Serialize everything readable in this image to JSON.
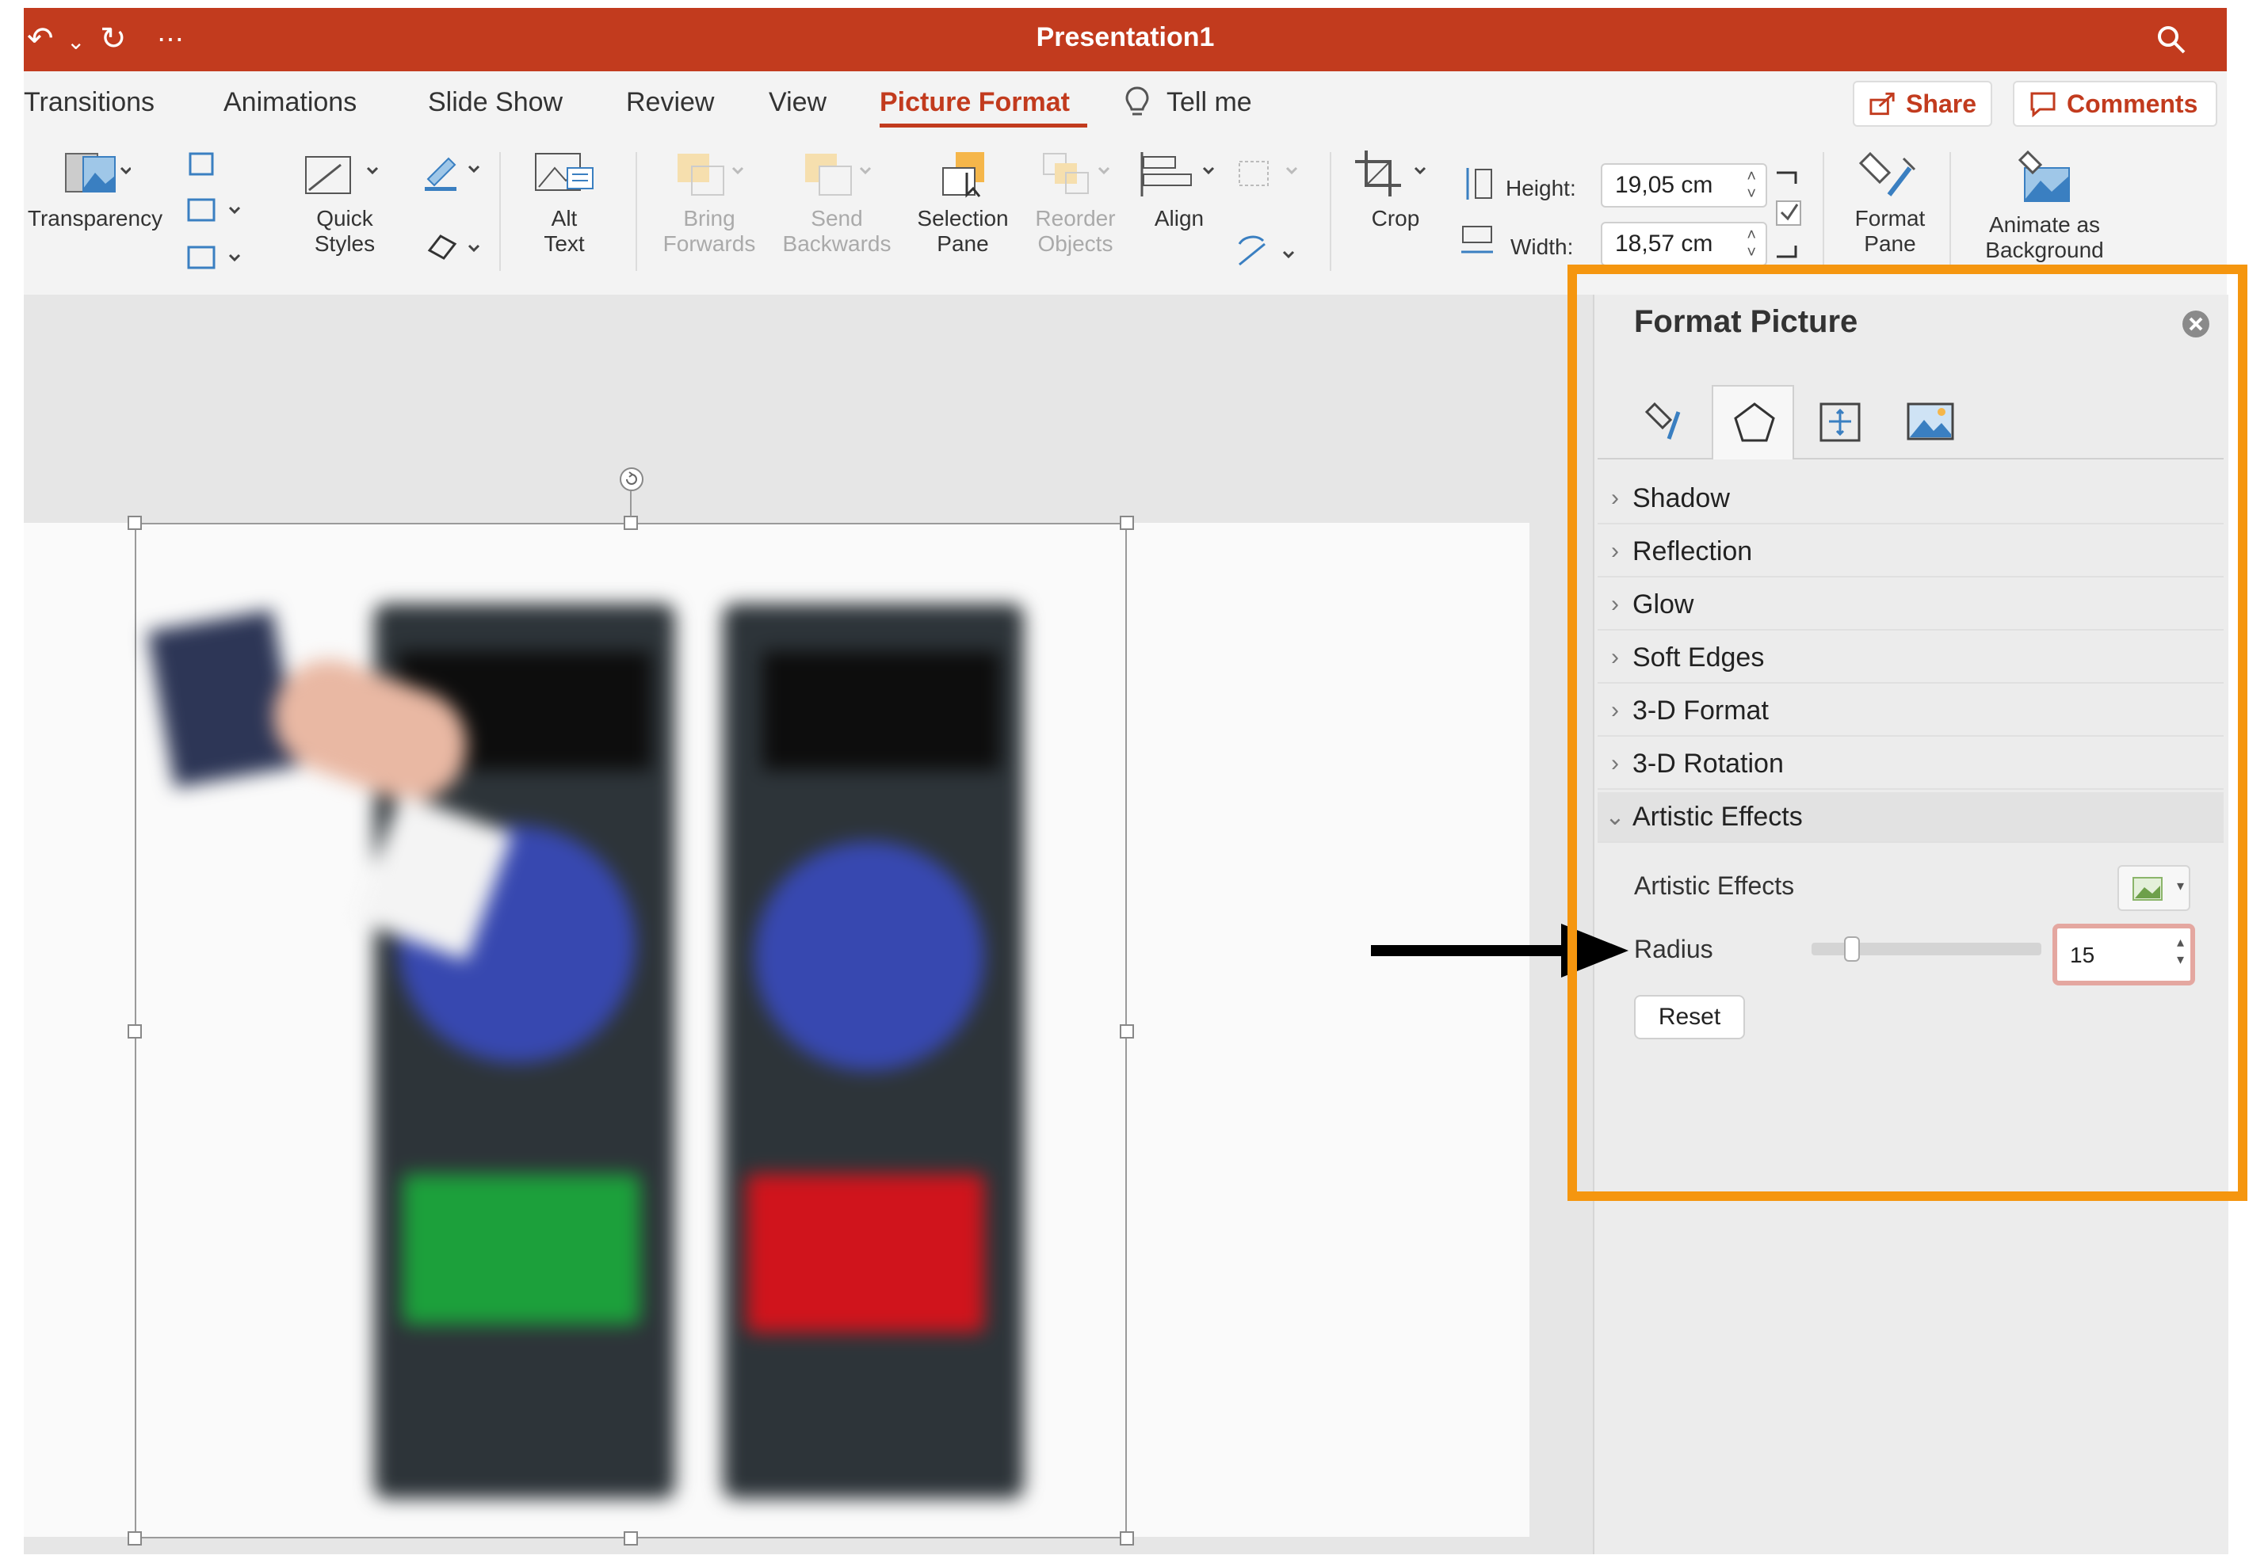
{
  "app": {
    "title": "Presentation1"
  },
  "tabs": [
    "Transitions",
    "Animations",
    "Slide Show",
    "Review",
    "View",
    "Picture Format",
    "Tell me"
  ],
  "header_buttons": {
    "share": "Share",
    "comments": "Comments"
  },
  "ribbon": {
    "transparency": "Transparency",
    "quick_styles": [
      "Quick",
      "Styles"
    ],
    "alt_text": [
      "Alt",
      "Text"
    ],
    "bring_forwards": [
      "Bring",
      "Forwards"
    ],
    "send_backwards": [
      "Send",
      "Backwards"
    ],
    "selection_pane": [
      "Selection",
      "Pane"
    ],
    "reorder_objects": [
      "Reorder",
      "Objects"
    ],
    "align": "Align",
    "crop": "Crop",
    "height_label": "Height:",
    "height_value": "19,05 cm",
    "width_label": "Width:",
    "width_value": "18,57 cm",
    "format_pane": [
      "Format",
      "Pane"
    ],
    "animate_as_background": [
      "Animate as",
      "Background"
    ]
  },
  "pane": {
    "title": "Format Picture",
    "sections": [
      "Shadow",
      "Reflection",
      "Glow",
      "Soft Edges",
      "3-D Format",
      "3-D Rotation"
    ],
    "expanded_section": "Artistic Effects",
    "artistic_effects_label": "Artistic Effects",
    "radius_label": "Radius",
    "radius_value": "15",
    "radius_fraction": 0.15,
    "reset_label": "Reset"
  },
  "colors": {
    "title_bar": "#c23b1e",
    "highlight": "#f5960f",
    "active_tab": "#c23b1e"
  }
}
